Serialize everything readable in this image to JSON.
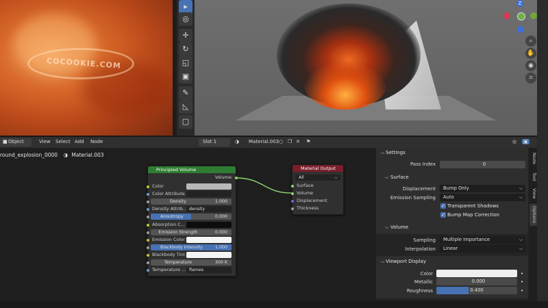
{
  "render": {
    "stamp_text": "COCOOKIE.COM"
  },
  "viewport": {
    "gizmo": {
      "z": "Z"
    },
    "tools": [
      "select-box-tool",
      "cursor-tool",
      "move-tool",
      "rotate-tool",
      "scale-tool",
      "transform-tool",
      "annotate-tool",
      "measure-tool",
      "add-cube-tool"
    ]
  },
  "node_header": {
    "mode": "Object",
    "menus": [
      "View",
      "Select",
      "Add",
      "Node"
    ],
    "slot": "Slot 1",
    "material": "Material.003"
  },
  "breadcrumb": {
    "object": "round_explosion_0000",
    "material": "Material.003"
  },
  "principled_volume": {
    "title": "Principled Volume",
    "output": "Volume",
    "rows": [
      {
        "label": "Color",
        "value": ""
      },
      {
        "label": "Color Attribute",
        "value": ""
      },
      {
        "label": "Density",
        "value": "1.000"
      },
      {
        "label": "Density Attrib...",
        "value": "density"
      },
      {
        "label": "Anisotropy",
        "value": "0.000"
      },
      {
        "label": "Absorption C...",
        "value": ""
      },
      {
        "label": "Emission Strength",
        "value": "0.000"
      },
      {
        "label": "Emission Color",
        "value": ""
      },
      {
        "label": "Blackbody Intensity",
        "value": "1.000"
      },
      {
        "label": "Blackbody Tint",
        "value": ""
      },
      {
        "label": "Temperature",
        "value": "300 K"
      },
      {
        "label": "Temperature ...",
        "value": "flames"
      }
    ]
  },
  "material_output": {
    "title": "Material Output",
    "target": "All",
    "inputs": [
      "Surface",
      "Volume",
      "Displacement",
      "Thickness"
    ]
  },
  "properties": {
    "settings_title": "Settings",
    "pass_index_label": "Pass Index",
    "pass_index_value": "0",
    "surface_title": "Surface",
    "displacement_label": "Displacement",
    "displacement_value": "Bump Only",
    "emission_sampling_label": "Emission Sampling",
    "emission_sampling_value": "Auto",
    "transparent_shadows": "Transparent Shadows",
    "bump_map_correction": "Bump Map Correction",
    "volume_title": "Volume",
    "sampling_label": "Sampling",
    "sampling_value": "Multiple Importance",
    "interpolation_label": "Interpolation",
    "interpolation_value": "Linear",
    "viewport_display_title": "Viewport Display",
    "color_label": "Color",
    "metallic_label": "Metallic",
    "metallic_value": "0.000",
    "roughness_label": "Roughness",
    "roughness_value": "0.400",
    "roughness_fraction": 0.4
  },
  "side_tabs": [
    "Node",
    "Tool",
    "View",
    "Options"
  ],
  "colors": {
    "accent": "#4772b3",
    "volume_node_header": "#2e7d32",
    "output_node_header": "#7a1f2a",
    "link": "#8fd66f"
  }
}
